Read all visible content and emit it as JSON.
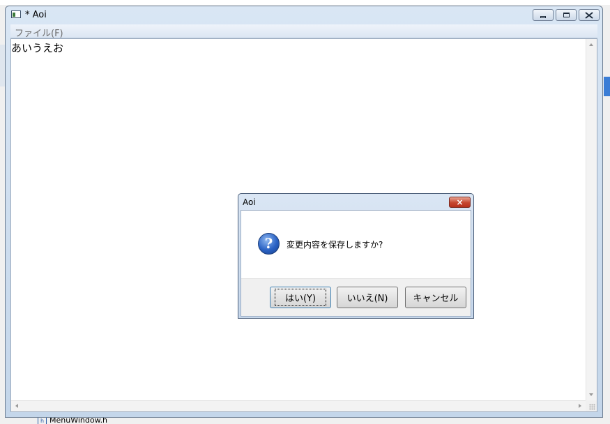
{
  "window": {
    "title": "* Aoi",
    "menu": {
      "file": "ファイル(F)"
    },
    "content_text": "あいうえお"
  },
  "dialog": {
    "title": "Aoi",
    "close_glyph": "×",
    "icon_glyph": "?",
    "message": "変更内容を保存しますか?",
    "buttons": {
      "yes": "はい(Y)",
      "no": "いいえ(N)",
      "cancel": "キャンセル"
    }
  },
  "background": {
    "tree_item_icon": "h",
    "tree_item": "MenuWindow.h"
  },
  "colors": {
    "dialog_close": "#c6462f",
    "question_icon": "#2a62c4"
  }
}
